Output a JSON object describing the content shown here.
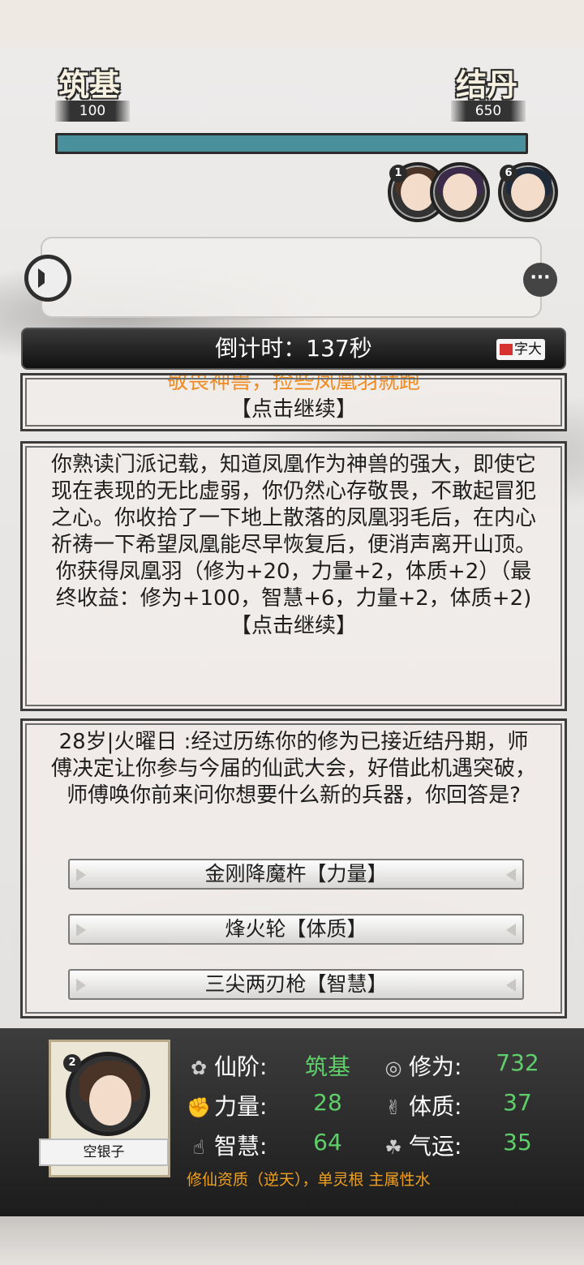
{
  "progress": {
    "current_realm": "筑基",
    "current_value": "100",
    "next_realm": "结丹",
    "next_value": "650",
    "fill_fraction": 1.0,
    "fill_color": "#4a8f9c"
  },
  "party": {
    "badge_first": "1",
    "badge_last": "6"
  },
  "chat": {
    "horn_icon": "horn-icon",
    "chat_icon_label": "···"
  },
  "countdown": {
    "text": "倒计时：137秒",
    "font_button": "字大"
  },
  "story": {
    "panel1_orange": "敬畏神兽，捡些凤凰羽就跑",
    "panel1_continue": "【点击继续】",
    "panel2_text": "你熟读门派记载，知道凤凰作为神兽的强大，即使它现在表现的无比虚弱，你仍然心存敬畏，不敢起冒犯之心。你收拾了一下地上散落的凤凰羽毛后，在内心祈祷一下希望凤凰能尽早恢复后，便消声离开山顶。你获得凤凰羽（修为+20，力量+2，体质+2）（最终收益：修为+100，智慧+6，力量+2，体质+2)",
    "panel2_continue": "【点击继续】",
    "panel3_text": "28岁|火曜日 :经过历练你的修为已接近结丹期，师傅决定让你参与今届的仙武大会，好借此机遇突破，师傅唤你前来问你想要什么新的兵器，你回答是?",
    "options": [
      "金刚降魔杵【力量】",
      "烽火轮【体质】",
      "三尖两刃枪【智慧】"
    ]
  },
  "player": {
    "badge": "2",
    "name": "空银子",
    "stats": {
      "realm_label": "仙阶:",
      "realm_value": "筑基",
      "cultivation_label": "修为:",
      "cultivation_value": "732",
      "strength_label": "力量:",
      "strength_value": "28",
      "constitution_label": "体质:",
      "constitution_value": "37",
      "wisdom_label": "智慧:",
      "wisdom_value": "64",
      "luck_label": "气运:",
      "luck_value": "35"
    },
    "aptitude": "修仙资质（逆天），单灵根 主属性水",
    "value_color": "#5fcf6a",
    "aptitude_color": "#f0a020"
  }
}
